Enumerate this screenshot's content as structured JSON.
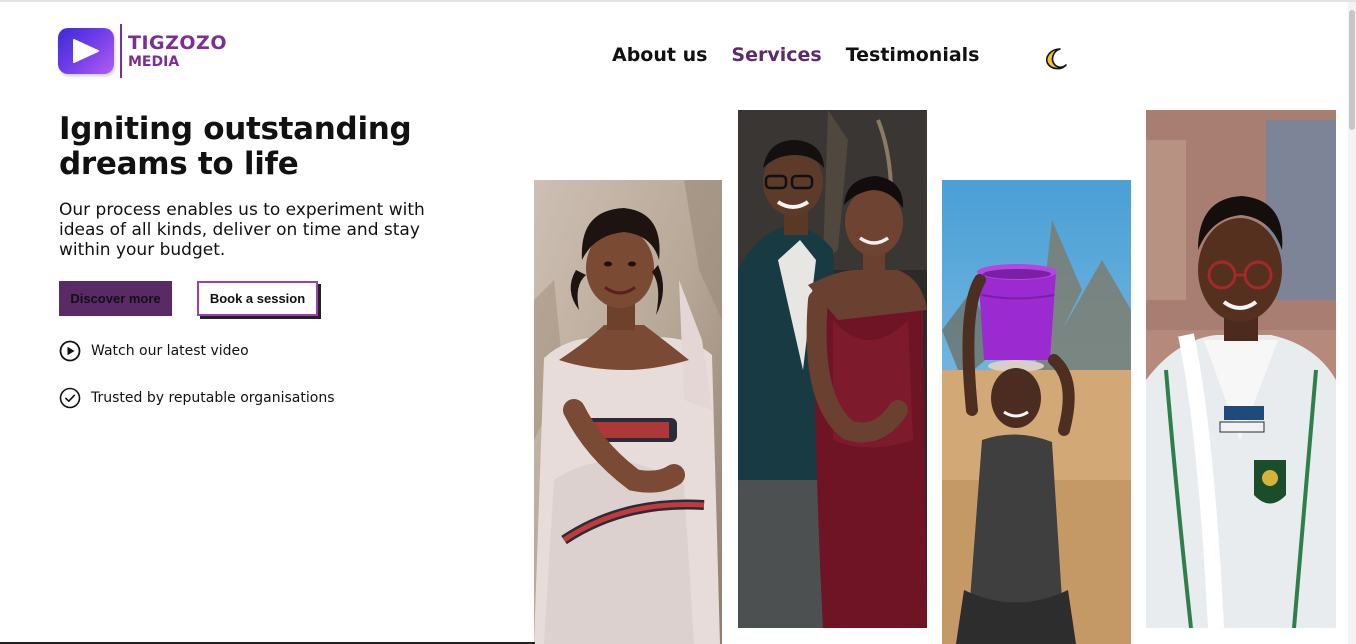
{
  "brand": {
    "line1": "TIGZOZO",
    "line2": "MEDIA",
    "color": "#7b2f95"
  },
  "nav": {
    "items": [
      {
        "label": "About us"
      },
      {
        "label": "Services"
      },
      {
        "label": "Testimonials"
      }
    ],
    "active": "Services",
    "theme_toggle_icon": "moon-icon"
  },
  "hero": {
    "title": "Igniting outstanding dreams to life",
    "subtitle": "Our process enables us to experiment with ideas of all kinds, deliver on time and stay within your budget.",
    "primary_button": "Discover more",
    "secondary_button": "Book a session",
    "features": [
      {
        "icon": "play-circle-icon",
        "label": "Watch our latest video"
      },
      {
        "icon": "check-circle-icon",
        "label": "Trusted by reputable organisations"
      }
    ]
  },
  "gallery": {
    "photos": [
      {
        "name": "bride-portrait-photo"
      },
      {
        "name": "couple-portrait-photo"
      },
      {
        "name": "child-with-bucket-photo"
      },
      {
        "name": "student-portrait-photo"
      }
    ]
  },
  "colors": {
    "accent": "#5a2a66",
    "active_nav": "#5c2b6e",
    "outline": "#9c3fb6"
  }
}
